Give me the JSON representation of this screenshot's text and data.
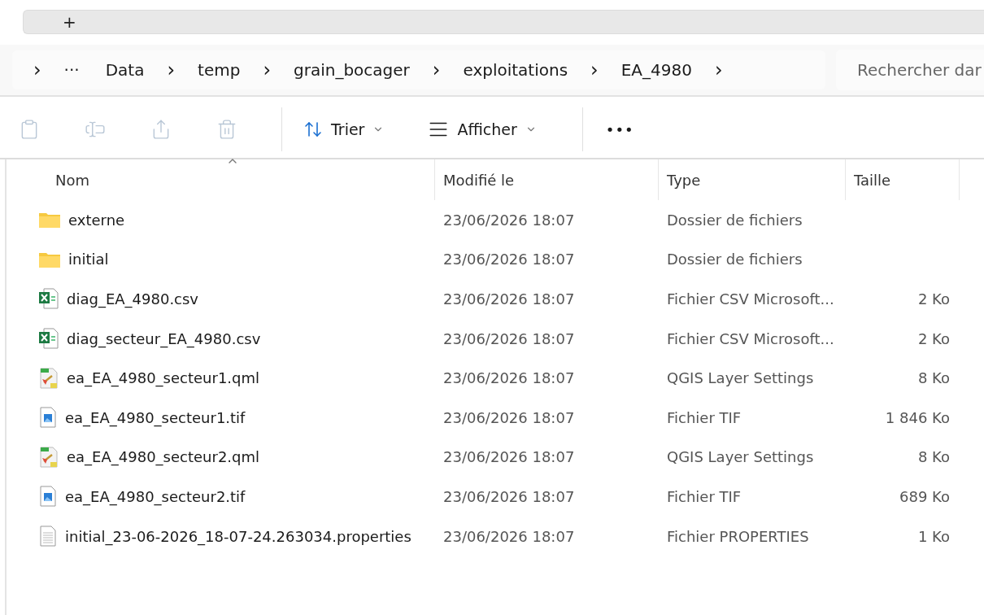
{
  "tab_strip": {
    "new_tab": "+"
  },
  "breadcrumb": {
    "items": [
      {
        "label": "›",
        "kind": "chevron"
      },
      {
        "label": "···",
        "kind": "more"
      },
      {
        "label": "Data",
        "kind": "folder"
      },
      {
        "label": "›",
        "kind": "chevron"
      },
      {
        "label": "temp",
        "kind": "folder"
      },
      {
        "label": "›",
        "kind": "chevron"
      },
      {
        "label": "grain_bocager",
        "kind": "folder"
      },
      {
        "label": "›",
        "kind": "chevron"
      },
      {
        "label": "exploitations",
        "kind": "folder"
      },
      {
        "label": "›",
        "kind": "chevron"
      },
      {
        "label": "EA_4980",
        "kind": "folder"
      },
      {
        "label": "›",
        "kind": "chevron"
      }
    ]
  },
  "search": {
    "placeholder": "Rechercher dar"
  },
  "toolbar": {
    "tools": [
      {
        "kind": "copy",
        "disabled": true
      },
      {
        "kind": "rename",
        "disabled": true
      },
      {
        "kind": "share",
        "disabled": true
      },
      {
        "kind": "delete",
        "disabled": true
      }
    ],
    "sort": "Trier",
    "view": "Afficher",
    "more": "•••"
  },
  "table": {
    "columns": [
      {
        "label": "Nom",
        "sorted": true
      },
      {
        "label": "Modifié le",
        "sorted": false
      },
      {
        "label": "Type",
        "sorted": false
      },
      {
        "label": "Taille",
        "sorted": false
      }
    ],
    "rows": [
      {
        "kind": "folder",
        "name": "externe",
        "modified": "23/06/2026 18:07",
        "type": "Dossier de fichiers"
      },
      {
        "kind": "folder",
        "name": "initial",
        "modified": "23/06/2026 18:07",
        "type": "Dossier de fichiers"
      },
      {
        "kind": "csv",
        "name": "diag_EA_4980.csv",
        "modified": "23/06/2026 18:07",
        "type": "Fichier CSV Microsoft...",
        "size": "2 Ko"
      },
      {
        "kind": "csv",
        "name": "diag_secteur_EA_4980.csv",
        "modified": "23/06/2026 18:07",
        "type": "Fichier CSV Microsoft...",
        "size": "2 Ko"
      },
      {
        "kind": "qml",
        "name": "ea_EA_4980_secteur1.qml",
        "modified": "23/06/2026 18:07",
        "type": "QGIS Layer Settings",
        "size": "8 Ko"
      },
      {
        "kind": "tif",
        "name": "ea_EA_4980_secteur1.tif",
        "modified": "23/06/2026 18:07",
        "type": "Fichier TIF",
        "size": "1 846 Ko"
      },
      {
        "kind": "qml",
        "name": "ea_EA_4980_secteur2.qml",
        "modified": "23/06/2026 18:07",
        "type": "QGIS Layer Settings",
        "size": "8 Ko"
      },
      {
        "kind": "tif",
        "name": "ea_EA_4980_secteur2.tif",
        "modified": "23/06/2026 18:07",
        "type": "Fichier TIF",
        "size": "689 Ko"
      },
      {
        "kind": "properties",
        "name": "initial_23-06-2026_18-07-24.263034.properties",
        "modified": "23/06/2026 18:07",
        "type": "Fichier PROPERTIES",
        "size": "1 Ko"
      }
    ]
  }
}
